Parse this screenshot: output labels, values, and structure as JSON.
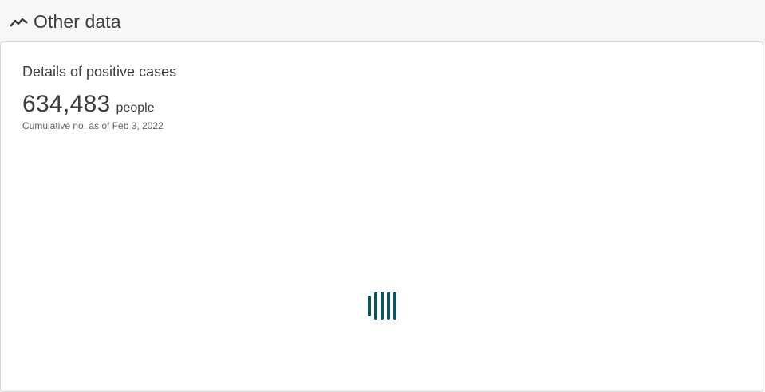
{
  "header": {
    "icon": "trend-line-icon",
    "title": "Other data"
  },
  "card": {
    "title": "Details of positive cases",
    "value": "634,483",
    "unit": "people",
    "note": "Cumulative no. as of Feb 3, 2022"
  },
  "loader": {
    "icon": "loading-bars-icon",
    "bars": 5
  },
  "colors": {
    "accent": "#0f5463",
    "background": "#f6f7f9",
    "card": "#ffffff",
    "text": "#3d3d3d"
  }
}
